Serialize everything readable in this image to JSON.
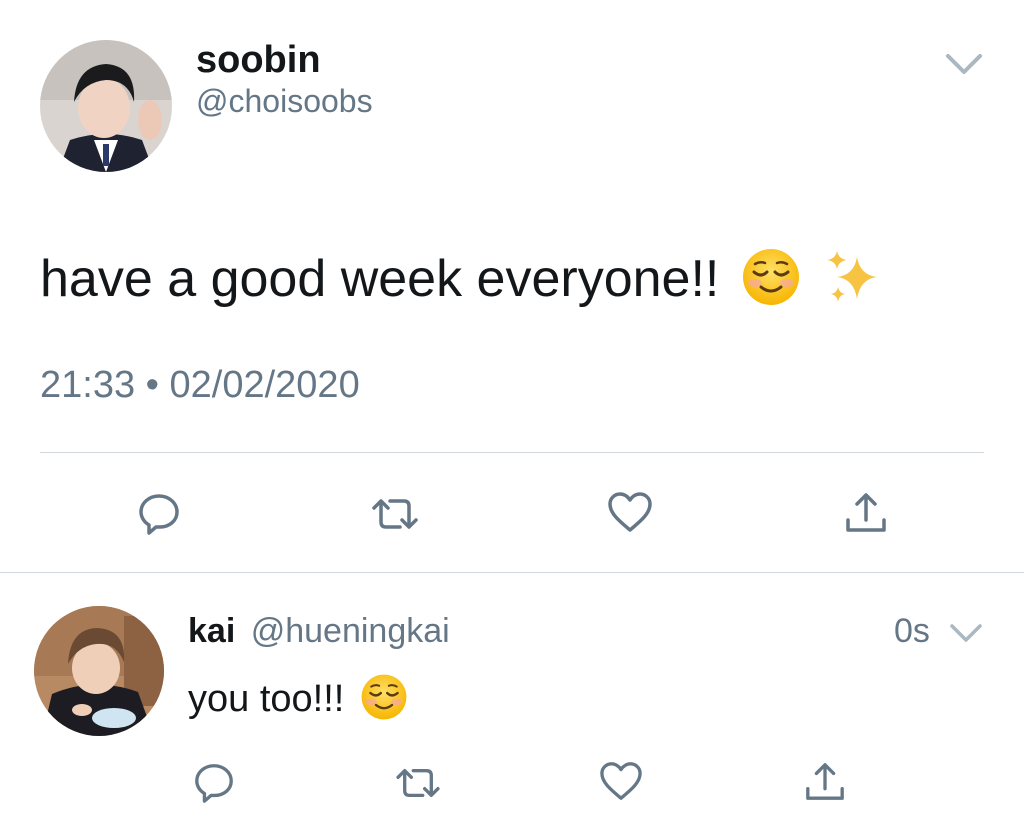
{
  "main_tweet": {
    "display_name": "soobin",
    "handle": "@choisoobs",
    "text": "have a good week everyone!!",
    "emojis": [
      "smiling-face-icon",
      "sparkles-icon"
    ],
    "timestamp": "21:33 • 02/02/2020",
    "actions": [
      "reply-icon",
      "retweet-icon",
      "like-icon",
      "share-icon"
    ],
    "menu_icon": "chevron-down-icon"
  },
  "reply_tweet": {
    "display_name": "kai",
    "handle": "@hueningkai",
    "time": "0s",
    "text": "you too!!!",
    "emojis": [
      "smiling-face-icon"
    ],
    "actions": [
      "reply-icon",
      "retweet-icon",
      "like-icon",
      "share-icon"
    ],
    "menu_icon": "chevron-down-icon"
  },
  "colors": {
    "text": "#14171a",
    "muted": "#657786",
    "divider": "#d3d8dc"
  }
}
